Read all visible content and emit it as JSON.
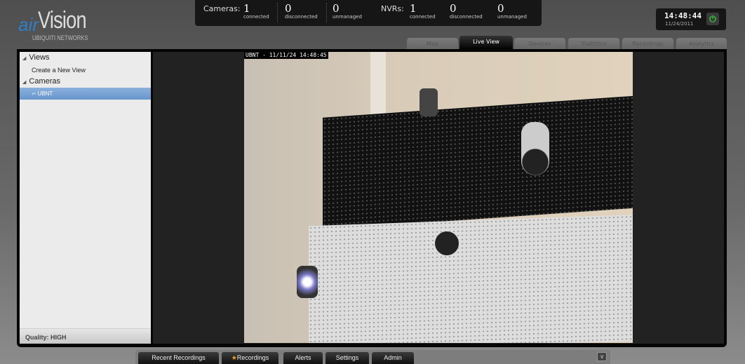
{
  "brand": {
    "logo_air": "air",
    "logo_vision": "Vision",
    "logo_sub": "UBIQUITI NETWORKS"
  },
  "stats": {
    "cameras_label": "Cameras:",
    "cameras": [
      {
        "value": "1",
        "label": "connected"
      },
      {
        "value": "0",
        "label": "disconnected"
      },
      {
        "value": "0",
        "label": "unmanaged"
      }
    ],
    "nvrs_label": "NVRs:",
    "nvrs": [
      {
        "value": "1",
        "label": "connected"
      },
      {
        "value": "0",
        "label": "disconnected"
      },
      {
        "value": "0",
        "label": "unmanaged"
      }
    ]
  },
  "clock": {
    "time": "14:48:44",
    "date": "11/24/2011",
    "power_icon": "⏻"
  },
  "tabs": [
    "Map",
    "Live View",
    "Devices",
    "Statistics",
    "Recordings",
    "Analytics"
  ],
  "active_tab": "Live View",
  "sidebar": {
    "views_label": "Views",
    "create_view": "Create a New View",
    "cameras_label": "Cameras",
    "camera": "UBNT",
    "quality": "Quality: HIGH"
  },
  "video": {
    "osd": "UBNT - 11/11/24 14:48:45"
  },
  "bottom_tabs": {
    "recent": "Recent Recordings",
    "recordings": "Recordings",
    "alerts": "Alerts",
    "settings": "Settings",
    "admin": "Admin",
    "chevron": "∨"
  }
}
